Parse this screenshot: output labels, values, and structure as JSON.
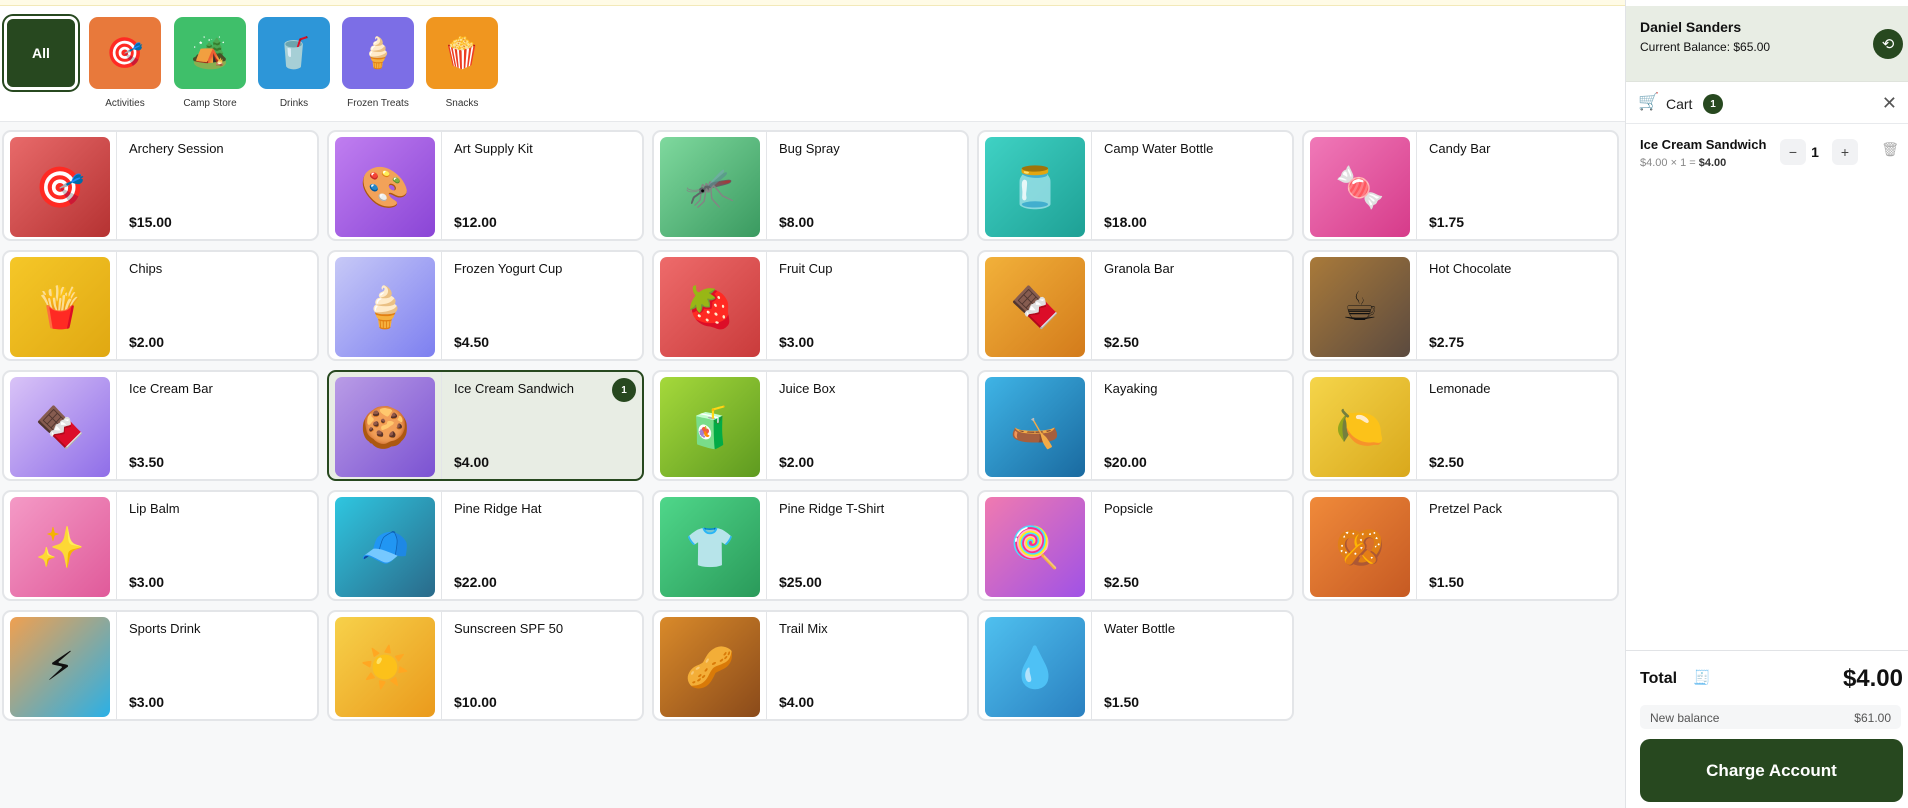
{
  "categories": [
    {
      "label": "All",
      "icon": "",
      "color": "#27481f"
    },
    {
      "label": "Activities",
      "icon": "🎯",
      "color": "#e8793b"
    },
    {
      "label": "Camp Store",
      "icon": "🏕️",
      "color": "#3fbf6a"
    },
    {
      "label": "Drinks",
      "icon": "🥤",
      "color": "#2d96d8"
    },
    {
      "label": "Frozen Treats",
      "icon": "🍦",
      "color": "#7c6ee6"
    },
    {
      "label": "Snacks",
      "icon": "🍿",
      "color": "#f0961f"
    }
  ],
  "products": [
    {
      "name": "Archery Session",
      "price": "$15.00",
      "icon": "🎯",
      "colors": [
        "#e86a6a",
        "#b53232"
      ]
    },
    {
      "name": "Art Supply Kit",
      "price": "$12.00",
      "icon": "🎨",
      "colors": [
        "#c07ef0",
        "#8a45d6"
      ]
    },
    {
      "name": "Bug Spray",
      "price": "$8.00",
      "icon": "🦟",
      "colors": [
        "#7fd99e",
        "#3a9a60"
      ]
    },
    {
      "name": "Camp Water Bottle",
      "price": "$18.00",
      "icon": "🫙",
      "colors": [
        "#3fd2c4",
        "#1ea095"
      ]
    },
    {
      "name": "Candy Bar",
      "price": "$1.75",
      "icon": "🍬",
      "colors": [
        "#f079b8",
        "#d63b8a"
      ]
    },
    {
      "name": "Chips",
      "price": "$2.00",
      "icon": "🍟",
      "colors": [
        "#f5c728",
        "#e0a812"
      ]
    },
    {
      "name": "Frozen Yogurt Cup",
      "price": "$4.50",
      "icon": "🍦",
      "colors": [
        "#c7c9f7",
        "#7d7ff0"
      ]
    },
    {
      "name": "Fruit Cup",
      "price": "$3.00",
      "icon": "🍓",
      "colors": [
        "#ee6b6b",
        "#c93b3b"
      ]
    },
    {
      "name": "Granola Bar",
      "price": "$2.50",
      "icon": "🍫",
      "colors": [
        "#f2b13a",
        "#d37b1b"
      ]
    },
    {
      "name": "Hot Chocolate",
      "price": "$2.75",
      "icon": "☕",
      "colors": [
        "#a97a3a",
        "#5b4a3f"
      ]
    },
    {
      "name": "Ice Cream Bar",
      "price": "$3.50",
      "icon": "🍫",
      "colors": [
        "#d9c3f7",
        "#8f6ee8"
      ]
    },
    {
      "name": "Ice Cream Sandwich",
      "price": "$4.00",
      "icon": "🍪",
      "colors": [
        "#b99ce6",
        "#7b52d2"
      ],
      "qty": "1"
    },
    {
      "name": "Juice Box",
      "price": "$2.00",
      "icon": "🧃",
      "colors": [
        "#a5d93b",
        "#5e9a20"
      ]
    },
    {
      "name": "Kayaking",
      "price": "$20.00",
      "icon": "🛶",
      "colors": [
        "#3fb4e6",
        "#1a6aa0"
      ]
    },
    {
      "name": "Lemonade",
      "price": "$2.50",
      "icon": "🍋",
      "colors": [
        "#f5d54a",
        "#d9a81c"
      ]
    },
    {
      "name": "Lip Balm",
      "price": "$3.00",
      "icon": "✨",
      "colors": [
        "#f49ac6",
        "#e05a9a"
      ]
    },
    {
      "name": "Pine Ridge Hat",
      "price": "$22.00",
      "icon": "🧢",
      "colors": [
        "#2fc6e0",
        "#2a6a8a"
      ]
    },
    {
      "name": "Pine Ridge T-Shirt",
      "price": "$25.00",
      "icon": "👕",
      "colors": [
        "#4fd78a",
        "#2a9a5a"
      ]
    },
    {
      "name": "Popsicle",
      "price": "$2.50",
      "icon": "🍭",
      "colors": [
        "#f07ab0",
        "#a052e6"
      ]
    },
    {
      "name": "Pretzel Pack",
      "price": "$1.50",
      "icon": "🥨",
      "colors": [
        "#f08a3a",
        "#c65a23"
      ]
    },
    {
      "name": "Sports Drink",
      "price": "$3.00",
      "icon": "⚡",
      "colors": [
        "#f0a050",
        "#2ab0e6"
      ]
    },
    {
      "name": "Sunscreen SPF 50",
      "price": "$10.00",
      "icon": "☀️",
      "colors": [
        "#f7d14a",
        "#ea9a1c"
      ]
    },
    {
      "name": "Trail Mix",
      "price": "$4.00",
      "icon": "🥜",
      "colors": [
        "#d98a2a",
        "#8a4a1a"
      ]
    },
    {
      "name": "Water Bottle",
      "price": "$1.50",
      "icon": "💧",
      "colors": [
        "#4fc0ef",
        "#2a80c0"
      ]
    }
  ],
  "account": {
    "name": "Daniel Sanders",
    "balance": "Current Balance: $65.00"
  },
  "cart": {
    "title": "Cart",
    "count": "1",
    "item": {
      "name": "Ice Cream Sandwich",
      "sub": "$4.00 × 1 = ",
      "line_total": "$4.00",
      "qty": "1"
    }
  },
  "footer": {
    "total_label": "Total",
    "total_value": "$4.00",
    "new_balance_label": "New balance",
    "new_balance_value": "$61.00",
    "charge_label": "Charge Account"
  }
}
